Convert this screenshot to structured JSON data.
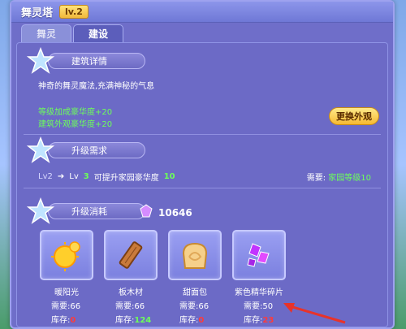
{
  "window": {
    "title": "舞灵塔",
    "level": "lv.2"
  },
  "tabs": [
    {
      "label": "舞灵",
      "active": false
    },
    {
      "label": "建设",
      "active": true
    }
  ],
  "building_details": {
    "header": "建筑详情",
    "description": "神奇的舞灵魔法,充满神秘的气息",
    "bonus_1": "等级加成豪华度+20",
    "bonus_2": "建筑外观豪华度+20",
    "change_button": "更换外观"
  },
  "upgrade_requirements": {
    "header": "升级需求",
    "current_level": "Lv2",
    "next_level_prefix": "Lv",
    "next_level_num": "3",
    "effect_text": "可提升家园豪华度",
    "effect_value": "10",
    "need_label": "需要:",
    "need_value": "家园等级10"
  },
  "upgrade_cost": {
    "header": "升级消耗",
    "crystal_total": "10646",
    "items": [
      {
        "name": "暖阳光",
        "need_label": "需要:",
        "need": "66",
        "stock_label": "库存:",
        "stock": "0",
        "stock_ok": false,
        "icon": "sun-icon"
      },
      {
        "name": "板木材",
        "need_label": "需要:",
        "need": "66",
        "stock_label": "库存:",
        "stock": "124",
        "stock_ok": true,
        "icon": "wood-plank-icon"
      },
      {
        "name": "甜面包",
        "need_label": "需要:",
        "need": "66",
        "stock_label": "库存:",
        "stock": "0",
        "stock_ok": false,
        "icon": "bread-icon"
      },
      {
        "name": "紫色精华碎片",
        "need_label": "需要:",
        "need": "50",
        "stock_label": "库存:",
        "stock": "23",
        "stock_ok": false,
        "icon": "purple-crystal-icon"
      }
    ]
  },
  "colors": {
    "accent_green": "#6dff5a",
    "accent_red": "#ff3b3b",
    "panel": "#6c6ac6",
    "button_gold": "#f6b932",
    "pointer": "#e8332a"
  }
}
